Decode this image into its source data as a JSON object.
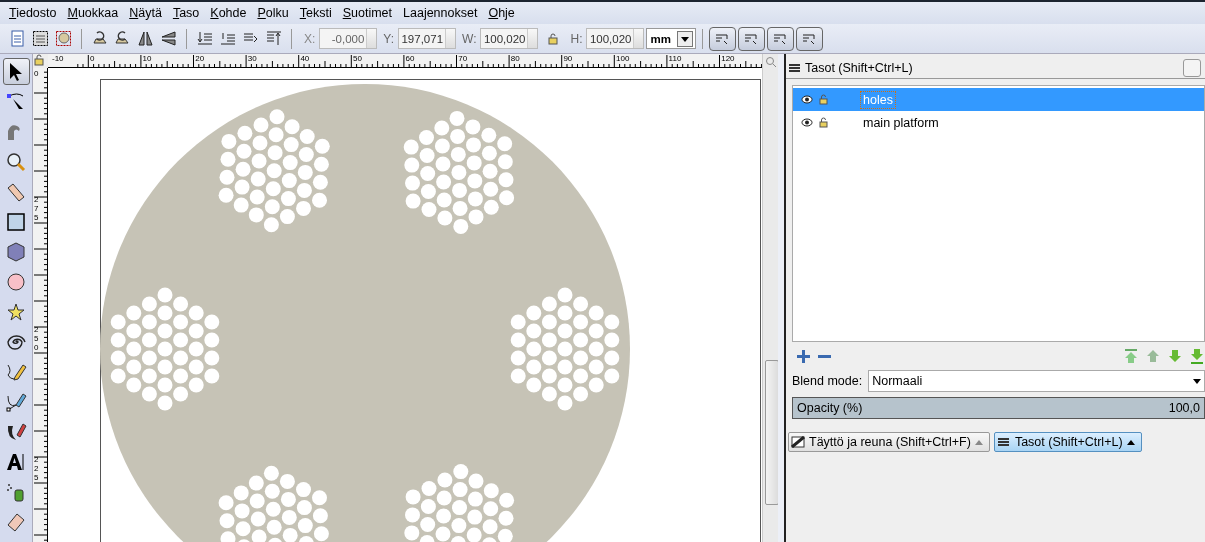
{
  "menu": [
    {
      "label": "Tiedosto",
      "mnemonic": true
    },
    {
      "label": "Muokkaa",
      "mnemonic": true
    },
    {
      "label": "Näytä",
      "mnemonic": true
    },
    {
      "label": "Taso",
      "mnemonic": true
    },
    {
      "label": "Kohde",
      "mnemonic": true
    },
    {
      "label": "Polku",
      "mnemonic": true
    },
    {
      "label": "Teksti",
      "mnemonic": true
    },
    {
      "label": "Suotimet",
      "mnemonic": true
    },
    {
      "label": "Laajennokset",
      "mnemonic": false
    },
    {
      "label": "Ohje",
      "mnemonic": true
    }
  ],
  "toolbar": {
    "fields": [
      {
        "label": "X:",
        "value": "-0,000",
        "disabled": true
      },
      {
        "label": "Y:",
        "value": "197,071",
        "disabled": false
      },
      {
        "label": "W:",
        "value": "100,020",
        "disabled": false
      },
      {
        "label": "H:",
        "value": "100,020",
        "disabled": false
      }
    ],
    "unit": "mm"
  },
  "tools": [
    {
      "selected": true
    },
    {
      "selected": false
    },
    {
      "selected": false
    },
    {
      "selected": false
    },
    {
      "selected": false
    },
    {
      "selected": false
    },
    {
      "selected": false
    },
    {
      "selected": false
    },
    {
      "selected": false
    },
    {
      "selected": false
    },
    {
      "selected": false
    },
    {
      "selected": false
    },
    {
      "selected": false
    },
    {
      "selected": false
    },
    {
      "selected": false
    },
    {
      "selected": false
    }
  ],
  "rulers": {
    "horizontal": [
      "-10",
      "0",
      "10",
      "20",
      "30",
      "40",
      "50",
      "60",
      "70",
      "80",
      "90",
      "100",
      "110",
      "120"
    ],
    "vertical": [
      "0",
      "275",
      "250",
      "225"
    ]
  },
  "layers_panel": {
    "title": "Tasot (Shift+Ctrl+L)",
    "layers": [
      {
        "name": "holes",
        "selected": true
      },
      {
        "name": "main platform",
        "selected": false
      }
    ],
    "blend_label": "Blend mode:",
    "blend_value": "Normaali",
    "opacity": {
      "label": "Opacity (%)",
      "value": "100,0",
      "level": 1.0
    }
  },
  "dock_tabs": [
    {
      "label": "Täyttö ja reuna (Shift+Ctrl+F)",
      "selected": false
    },
    {
      "label": "Tasot (Shift+Ctrl+L)",
      "selected": true
    }
  ]
}
